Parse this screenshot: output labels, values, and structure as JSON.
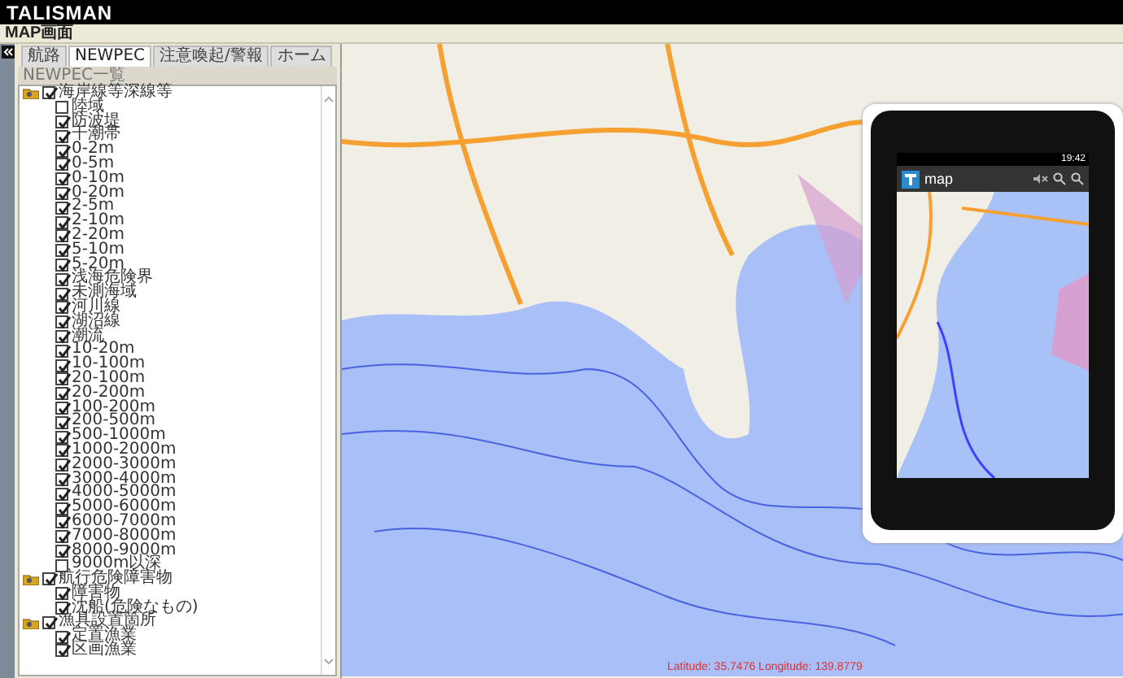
{
  "app_title": "TALISMAN",
  "screen_label": "MAP画面",
  "tabs": [
    {
      "label": "航路",
      "selected": false
    },
    {
      "label": "NEWPEC",
      "selected": true
    },
    {
      "label": "注意喚起/警報",
      "selected": false
    },
    {
      "label": "ホーム",
      "selected": false
    }
  ],
  "list_header": "NEWPEC一覧",
  "tree": [
    {
      "label": "海岸線等深線等",
      "checked": true,
      "expanded": true,
      "children": [
        {
          "label": "陸域",
          "checked": false
        },
        {
          "label": "防波堤",
          "checked": true
        },
        {
          "label": "干潮帯",
          "checked": true
        },
        {
          "label": "0-2m",
          "checked": true
        },
        {
          "label": "0-5m",
          "checked": true
        },
        {
          "label": "0-10m",
          "checked": true
        },
        {
          "label": "0-20m",
          "checked": true
        },
        {
          "label": "2-5m",
          "checked": true
        },
        {
          "label": "2-10m",
          "checked": true
        },
        {
          "label": "2-20m",
          "checked": true
        },
        {
          "label": "5-10m",
          "checked": true
        },
        {
          "label": "5-20m",
          "checked": true
        },
        {
          "label": "浅海危険界",
          "checked": true
        },
        {
          "label": "未測海域",
          "checked": true
        },
        {
          "label": "河川線",
          "checked": true
        },
        {
          "label": "湖沼線",
          "checked": true
        },
        {
          "label": "潮流",
          "checked": true
        },
        {
          "label": "10-20m",
          "checked": true
        },
        {
          "label": "10-100m",
          "checked": true
        },
        {
          "label": "20-100m",
          "checked": true
        },
        {
          "label": "20-200m",
          "checked": true
        },
        {
          "label": "100-200m",
          "checked": true
        },
        {
          "label": "200-500m",
          "checked": true
        },
        {
          "label": "500-1000m",
          "checked": true
        },
        {
          "label": "1000-2000m",
          "checked": true
        },
        {
          "label": "2000-3000m",
          "checked": true
        },
        {
          "label": "3000-4000m",
          "checked": true
        },
        {
          "label": "4000-5000m",
          "checked": true
        },
        {
          "label": "5000-6000m",
          "checked": true
        },
        {
          "label": "6000-7000m",
          "checked": true
        },
        {
          "label": "7000-8000m",
          "checked": true
        },
        {
          "label": "8000-9000m",
          "checked": true
        },
        {
          "label": "9000m以深",
          "checked": false
        }
      ]
    },
    {
      "label": "航行危険障害物",
      "checked": true,
      "expanded": true,
      "children": [
        {
          "label": "障害物",
          "checked": true
        },
        {
          "label": "沈船(危険なもの)",
          "checked": true
        }
      ]
    },
    {
      "label": "漁具設置箇所",
      "checked": true,
      "expanded": true,
      "children": [
        {
          "label": "定置漁業",
          "checked": true
        },
        {
          "label": "区画漁業",
          "checked": true
        }
      ]
    }
  ],
  "map": {
    "coordinates": "Latitude: 35.7476 Longitude: 139.8779"
  },
  "phone": {
    "clock": "19:42",
    "app_name": "map"
  }
}
